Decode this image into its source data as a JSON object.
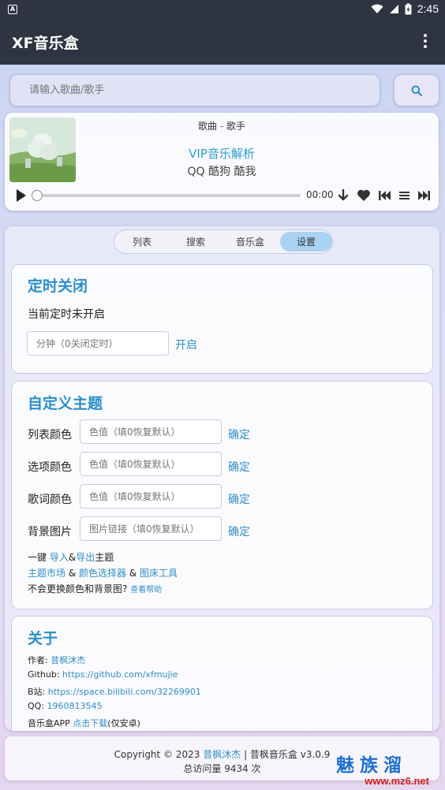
{
  "status_bar": {
    "time": "2:45"
  },
  "app_bar": {
    "title": "XF音乐盒"
  },
  "search": {
    "placeholder": "请输入歌曲/歌手"
  },
  "player": {
    "song": "歌曲",
    "separator": " - ",
    "artist": "歌手",
    "vip_link": "VIP音乐解析",
    "platforms": "QQ 酷狗 酷我",
    "time": "00:00",
    "progress": 0
  },
  "tabs": [
    {
      "label": "列表"
    },
    {
      "label": "搜索"
    },
    {
      "label": "音乐盒"
    },
    {
      "label": "设置",
      "active": true
    }
  ],
  "timer": {
    "title": "定时关闭",
    "status": "当前定时未开启",
    "placeholder": "分钟（0关闭定时）",
    "action": "开启"
  },
  "theme": {
    "title": "自定义主题",
    "rows": [
      {
        "label": "列表颜色",
        "placeholder": "色值（填0恢复默认）",
        "action": "确定"
      },
      {
        "label": "选项颜色",
        "placeholder": "色值（填0恢复默认）",
        "action": "确定"
      },
      {
        "label": "歌词颜色",
        "placeholder": "色值（填0恢复默认）",
        "action": "确定"
      },
      {
        "label": "背景图片",
        "placeholder": "图片链接（填0恢复默认）",
        "action": "确定"
      }
    ],
    "oneclick_prefix": "一键 ",
    "import": "导入",
    "amp": "&",
    "export": "导出",
    "oneclick_suffix": "主题",
    "market": "主题市场",
    "amp2": " & ",
    "color_picker": "颜色选择器",
    "amp3": " & ",
    "image_tool": "图床工具",
    "help_question": "不会更换颜色和背景图?",
    "help_link": "查看帮助"
  },
  "about": {
    "title": "关于",
    "author_label": "作者: ",
    "author": "昔枫沐杰",
    "github_label": "Github: ",
    "github": "https://github.com/xfmujie",
    "bilibili_label": "B站: ",
    "bilibili": "https://space.bilibili.com/32269901",
    "qq_label": "QQ: ",
    "qq": "1960813545",
    "app_label": "音乐盒APP ",
    "app_link": "点击下载",
    "app_suffix": "(仅安卓)"
  },
  "footer": {
    "copyright_prefix": "Copyright © 2023 ",
    "author_link": "昔枫沐杰",
    "copyright_suffix": " | 昔枫音乐盒 v3.0.9",
    "visits": "总访问量 9434 次"
  },
  "watermark": {
    "brand": "魅族溜",
    "url": "www.mz6.net"
  },
  "colors": {
    "accent": "#2e8fc6",
    "appbar": "#2f3442",
    "active_tab": "#a9d2f3"
  }
}
